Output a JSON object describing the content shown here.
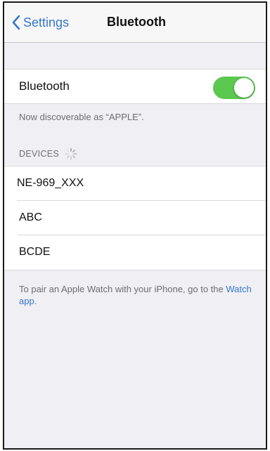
{
  "navbar": {
    "back_label": "Settings",
    "title": "Bluetooth"
  },
  "bluetooth": {
    "label": "Bluetooth",
    "enabled": true,
    "toggle_color": "#5bc84f"
  },
  "discoverable_text": "Now discoverable as “APPLE”.",
  "devices": {
    "header": "DEVICES",
    "loading": true,
    "items": [
      {
        "name": "NE-969_XXX"
      },
      {
        "name": "ABC"
      },
      {
        "name": "BCDE"
      }
    ]
  },
  "footer": {
    "text_before_link": "To pair an Apple Watch with your iPhone, go to the ",
    "link_text": "Watch app",
    "text_after_link": "."
  },
  "colors": {
    "accent": "#3478c8",
    "background": "#efeff4"
  }
}
